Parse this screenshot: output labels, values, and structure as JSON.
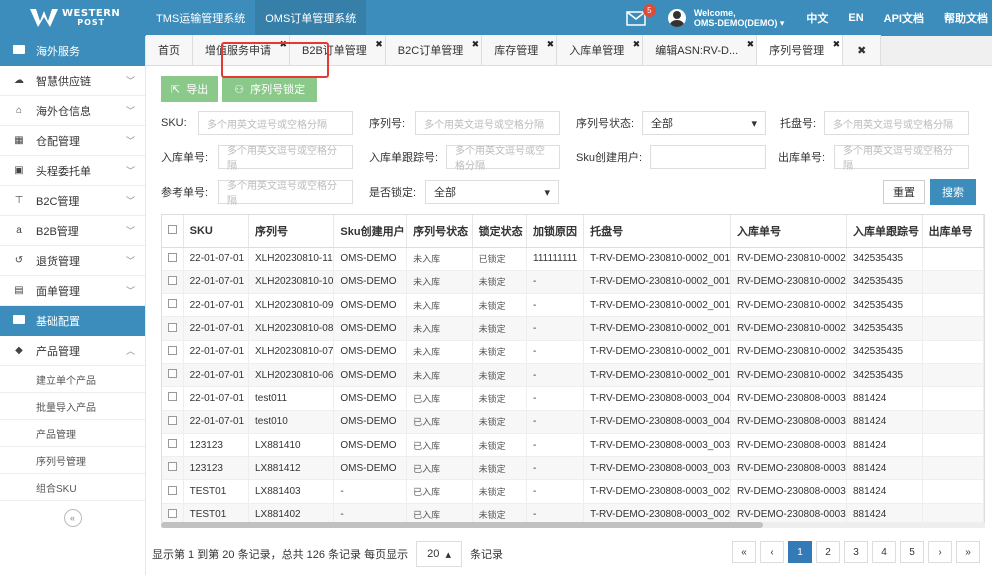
{
  "header": {
    "logo_line1": "WESTERN",
    "logo_line2": "POST",
    "systems": [
      "TMS运输管理系统",
      "OMS订单管理系统"
    ],
    "mail_count": "5",
    "welcome": "Welcome,",
    "user_name": "OMS-DEMO(DEMO)",
    "links": [
      "中文",
      "EN",
      "API文档",
      "帮助文档"
    ]
  },
  "sidebar": {
    "section1": "海外服务",
    "items": [
      {
        "label": "智慧供应链",
        "icon": "cloud-icon"
      },
      {
        "label": "海外仓信息",
        "icon": "home-icon"
      },
      {
        "label": "仓配管理",
        "icon": "grid-icon"
      },
      {
        "label": "头程委托单",
        "icon": "briefcase-icon"
      },
      {
        "label": "B2C管理",
        "icon": "cart-icon"
      },
      {
        "label": "B2B管理",
        "icon": "amazon-icon"
      },
      {
        "label": "退货管理",
        "icon": "return-icon"
      },
      {
        "label": "面单管理",
        "icon": "document-icon"
      }
    ],
    "section2": "基础配置",
    "product_menu": "产品管理",
    "sub_items": [
      "建立单个产品",
      "批量导入产品",
      "产品管理",
      "序列号管理",
      "组合SKU"
    ]
  },
  "tabs": [
    "首页",
    "增值服务申请",
    "B2B订单管理",
    "B2C订单管理",
    "库存管理",
    "入库单管理",
    "编辑ASN:RV-D...",
    "序列号管理"
  ],
  "toolbar": {
    "export": "导出",
    "lock": "序列号锁定"
  },
  "filters": {
    "sku": "SKU:",
    "serial": "序列号:",
    "serial_status": "序列号状态:",
    "pallet": "托盘号:",
    "inbound_no": "入库单号:",
    "inbound_track": "入库单跟踪号:",
    "sku_user": "Sku创建用户:",
    "outbound_no": "出库单号:",
    "ref_no": "参考单号:",
    "locked": "是否锁定:",
    "placeholder": "多个用英文逗号或空格分隔",
    "all": "全部",
    "reset": "重置",
    "search": "搜索"
  },
  "table": {
    "columns": [
      "SKU",
      "序列号",
      "Sku创建用户",
      "序列号状态",
      "锁定状态",
      "加锁原因",
      "托盘号",
      "入库单号",
      "入库单跟踪号",
      "出库单号"
    ],
    "rows": [
      [
        "22-01-07-01",
        "XLH20230810-11",
        "OMS-DEMO",
        "未入库",
        "已锁定",
        "111111111",
        "T-RV-DEMO-230810-0002_001",
        "RV-DEMO-230810-0002",
        "342535435",
        ""
      ],
      [
        "22-01-07-01",
        "XLH20230810-10",
        "OMS-DEMO",
        "未入库",
        "未锁定",
        "-",
        "T-RV-DEMO-230810-0002_001",
        "RV-DEMO-230810-0002",
        "342535435",
        ""
      ],
      [
        "22-01-07-01",
        "XLH20230810-09",
        "OMS-DEMO",
        "未入库",
        "未锁定",
        "-",
        "T-RV-DEMO-230810-0002_001",
        "RV-DEMO-230810-0002",
        "342535435",
        ""
      ],
      [
        "22-01-07-01",
        "XLH20230810-08",
        "OMS-DEMO",
        "未入库",
        "未锁定",
        "-",
        "T-RV-DEMO-230810-0002_001",
        "RV-DEMO-230810-0002",
        "342535435",
        ""
      ],
      [
        "22-01-07-01",
        "XLH20230810-07",
        "OMS-DEMO",
        "未入库",
        "未锁定",
        "-",
        "T-RV-DEMO-230810-0002_001",
        "RV-DEMO-230810-0002",
        "342535435",
        ""
      ],
      [
        "22-01-07-01",
        "XLH20230810-06",
        "OMS-DEMO",
        "未入库",
        "未锁定",
        "-",
        "T-RV-DEMO-230810-0002_001",
        "RV-DEMO-230810-0002",
        "342535435",
        ""
      ],
      [
        "22-01-07-01",
        "test011",
        "OMS-DEMO",
        "已入库",
        "未锁定",
        "-",
        "T-RV-DEMO-230808-0003_004",
        "RV-DEMO-230808-0003",
        "881424",
        ""
      ],
      [
        "22-01-07-01",
        "test010",
        "OMS-DEMO",
        "已入库",
        "未锁定",
        "-",
        "T-RV-DEMO-230808-0003_004",
        "RV-DEMO-230808-0003",
        "881424",
        ""
      ],
      [
        "123123",
        "LX881410",
        "OMS-DEMO",
        "已入库",
        "未锁定",
        "-",
        "T-RV-DEMO-230808-0003_003",
        "RV-DEMO-230808-0003",
        "881424",
        ""
      ],
      [
        "123123",
        "LX881412",
        "OMS-DEMO",
        "已入库",
        "未锁定",
        "-",
        "T-RV-DEMO-230808-0003_003",
        "RV-DEMO-230808-0003",
        "881424",
        ""
      ],
      [
        "TEST01",
        "LX881403",
        "-",
        "已入库",
        "未锁定",
        "-",
        "T-RV-DEMO-230808-0003_002",
        "RV-DEMO-230808-0003",
        "881424",
        ""
      ],
      [
        "TEST01",
        "LX881402",
        "-",
        "已入库",
        "未锁定",
        "-",
        "T-RV-DEMO-230808-0003_002",
        "RV-DEMO-230808-0003",
        "881424",
        ""
      ]
    ]
  },
  "footer": {
    "summary": "显示第 1 到第 20 条记录，总共 126 条记录 每页显示",
    "page_size": "20",
    "suffix": "条记录",
    "pages": [
      "1",
      "2",
      "3",
      "4",
      "5"
    ],
    "current_page": "1"
  },
  "colors": {
    "primary": "#3c8dbc",
    "green": "#8bc98a",
    "highlight": "#e53935"
  }
}
